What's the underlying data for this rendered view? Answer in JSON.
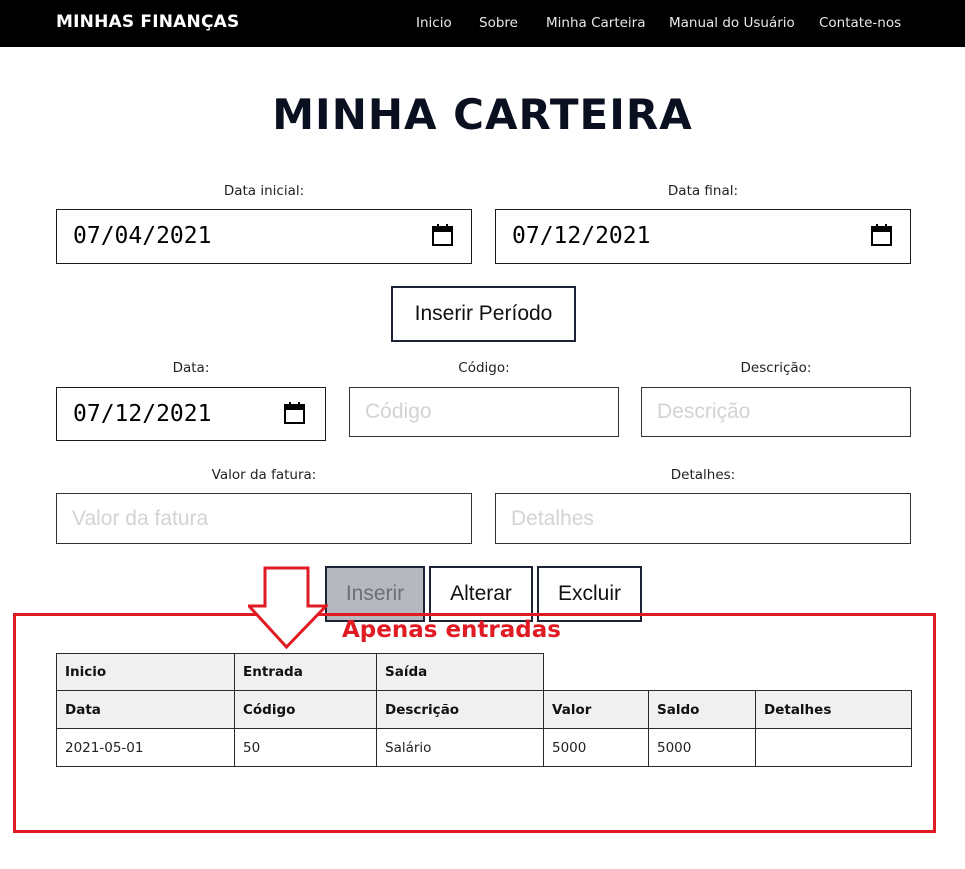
{
  "navbar": {
    "brand": "MINHAS FINANÇAS",
    "links": [
      "Inicio",
      "Sobre",
      "Minha Carteira",
      "Manual do Usuário",
      "Contate-nos"
    ]
  },
  "page": {
    "title": "MINHA CARTEIRA"
  },
  "period": {
    "start_label": "Data inicial:",
    "start_value": "07/04/2021",
    "end_label": "Data final:",
    "end_value": "07/12/2021",
    "submit_label": "Inserir Período"
  },
  "entry_form": {
    "date_label": "Data:",
    "date_value": "07/12/2021",
    "code_label": "Código:",
    "code_placeholder": "Código",
    "description_label": "Descrição:",
    "description_placeholder": "Descrição",
    "amount_label": "Valor da fatura:",
    "amount_placeholder": "Valor da fatura",
    "details_label": "Detalhes:",
    "details_placeholder": "Detalhes"
  },
  "actions": {
    "insert": "Inserir",
    "update": "Alterar",
    "delete": "Excluir"
  },
  "annotation": {
    "text": "Apenas entradas",
    "color": "#e01b24"
  },
  "table": {
    "group_headers": [
      "Inicio",
      "Entrada",
      "Saída"
    ],
    "columns": [
      "Data",
      "Código",
      "Descrição",
      "Valor",
      "Saldo",
      "Detalhes"
    ],
    "rows": [
      [
        "2021-05-01",
        "50",
        "Salário",
        "5000",
        "5000",
        ""
      ]
    ]
  },
  "icons": {
    "date_picker": "calendar-icon",
    "annotation_arrow": "down-arrow-icon"
  }
}
